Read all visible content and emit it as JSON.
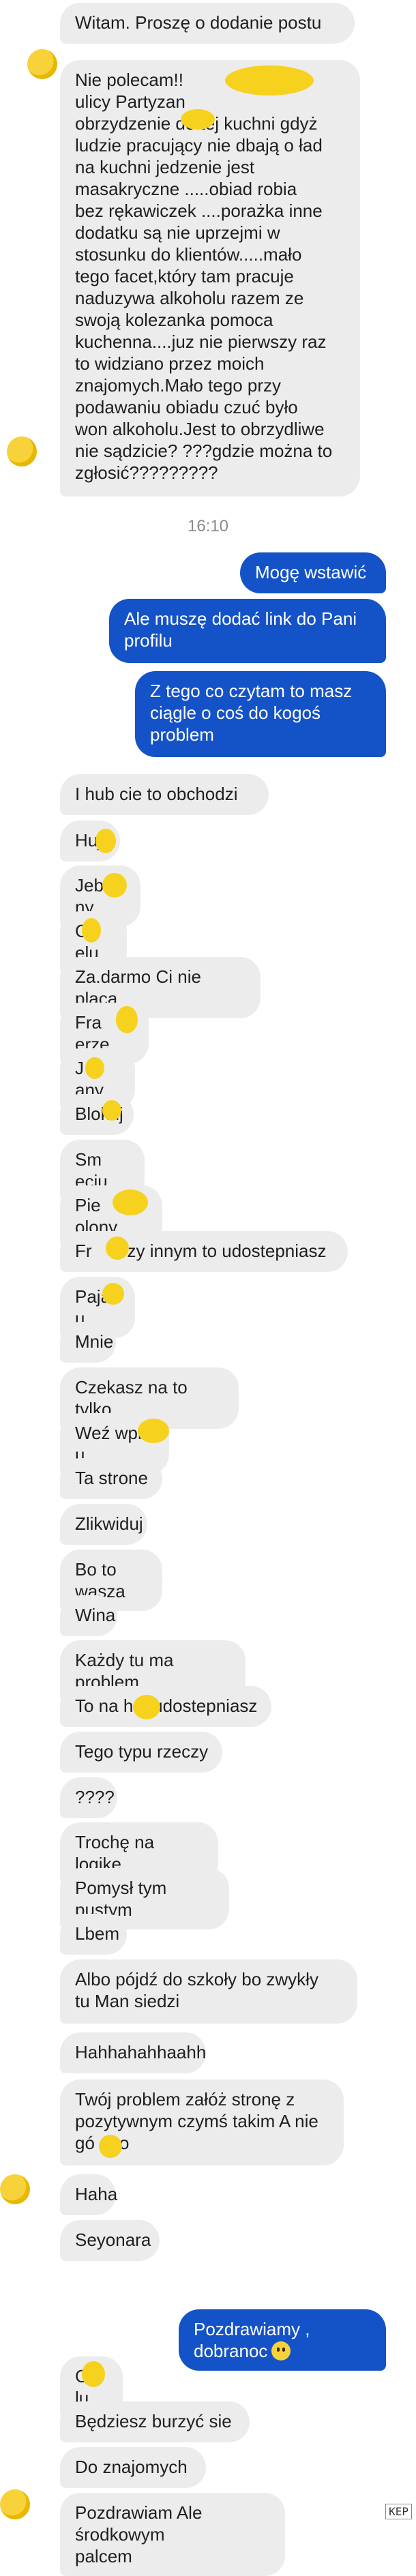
{
  "messages": [
    {
      "side": "in",
      "text": "Witam. Proszę o dodanie postu"
    },
    {
      "side": "in",
      "text": "Nie polecam!!            k przy\nulicy Partyzan\nobrzydzenie do tej kuchni gdyż\nludzie pracujący nie dbają o ład\nna kuchni jedzenie jest\nmasakryczne .....obiad robia\nbez rękawiczek ....porażka inne\ndodatku są nie uprzejmi w\nstosunku do klientów.....mało\ntego facet,który tam pracuje\nnaduzywa alkoholu razem ze\nswoją kolezanka pomoca\nkuchenna....juz nie pierwszy raz\nto widziano przez moich\nznajomych.Mało tego przy\npodawaniu obiadu czuć było\nwon alkoholu.Jest to obrzydliwe\nnie sądzicie? ???gdzie można to\nzgłosić?????????"
    },
    {
      "side": "out",
      "text": "Mogę wstawić"
    },
    {
      "side": "out",
      "text": "Ale muszę dodać link do Pani\nprofilu"
    },
    {
      "side": "out",
      "text": "Z tego co czytam to masz\nciągle o coś do kogoś\nproblem"
    },
    {
      "side": "in",
      "text": "I hub cie to obchodzi"
    },
    {
      "side": "in",
      "text": "Huj"
    },
    {
      "side": "in",
      "text": "Jeb    ny"
    },
    {
      "side": "in",
      "text": "Cw  elu"
    },
    {
      "side": "in",
      "text": "Za.darmo Ci nie placa"
    },
    {
      "side": "in",
      "text": "Fra   erze"
    },
    {
      "side": "in",
      "text": "J    any"
    },
    {
      "side": "in",
      "text": "Blokuj"
    },
    {
      "side": "in",
      "text": "Sm    eciu"
    },
    {
      "side": "in",
      "text": "Pie     olony"
    },
    {
      "side": "in",
      "text": "Fr    erzy innym to udostepniasz"
    },
    {
      "side": "in",
      "text": "Paja   u"
    },
    {
      "side": "in",
      "text": "Mnie"
    },
    {
      "side": "in",
      "text": "Czekasz na to tylko"
    },
    {
      "side": "in",
      "text": "Weź wpi    u"
    },
    {
      "side": "in",
      "text": "Ta strone"
    },
    {
      "side": "in",
      "text": "Zlikwiduj"
    },
    {
      "side": "in",
      "text": "Bo to wasza"
    },
    {
      "side": "in",
      "text": "Wina"
    },
    {
      "side": "in",
      "text": "Każdy tu ma problem"
    },
    {
      "side": "in",
      "text": "To na h    udostepniasz"
    },
    {
      "side": "in",
      "text": "Tego typu rzeczy"
    },
    {
      "side": "in",
      "text": "????"
    },
    {
      "side": "in",
      "text": "Trochę na logike"
    },
    {
      "side": "in",
      "text": "Pomysł tym pustym"
    },
    {
      "side": "in",
      "text": "Lbem"
    },
    {
      "side": "in",
      "text": "Albo pójdź do szkoły bo zwykły\ntu Man siedzi"
    },
    {
      "side": "in",
      "text": "Hahhahahhaahh"
    },
    {
      "side": "in",
      "text": "Twój problem załóż stronę z\npozytywnym czymś takim A nie\ngó   no"
    },
    {
      "side": "in",
      "text": "Haha"
    },
    {
      "side": "in",
      "text": "Seyonara"
    },
    {
      "side": "out",
      "text": "Pozdrawiamy , dobranoc"
    },
    {
      "side": "in",
      "text": "Cw  lu"
    },
    {
      "side": "in",
      "text": "Będziesz burzyć sie"
    },
    {
      "side": "in",
      "text": "Do znajomych"
    },
    {
      "side": "in",
      "text": "Pozdrawiam Ale środkowym\npalcem"
    }
  ],
  "timestamp": "16:10",
  "watermark": "KEP",
  "colors": {
    "incoming": "#ececec",
    "outgoing": "#1452c7",
    "blot": "#f6d21f"
  }
}
